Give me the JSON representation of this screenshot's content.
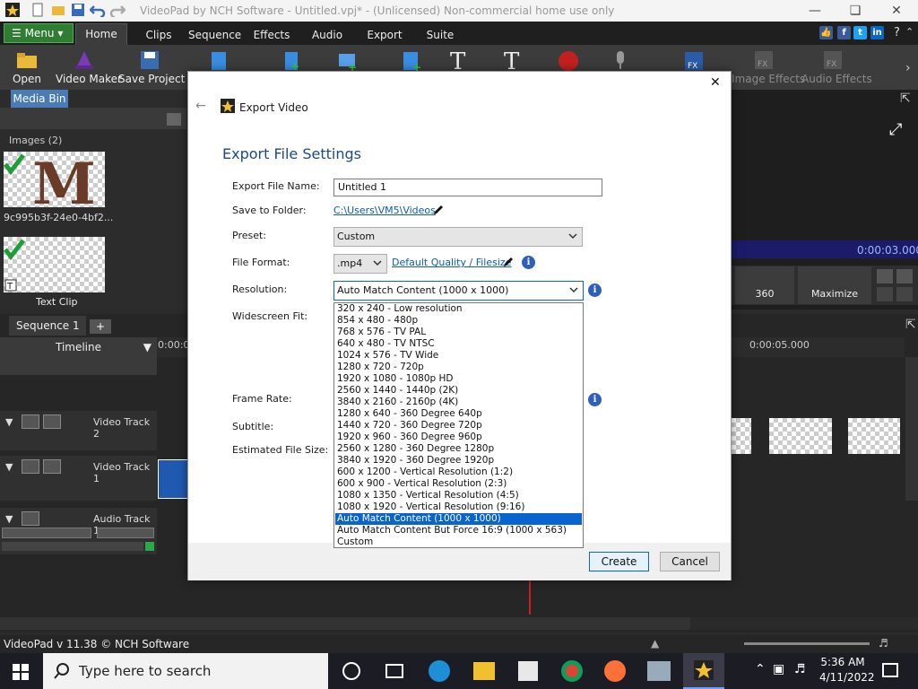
{
  "window": {
    "title": "VideoPad by NCH Software - Untitled.vpj* - (Unlicensed) Non-commercial home use only"
  },
  "tabs": {
    "menu": "Menu",
    "items": [
      "Home",
      "Clips",
      "Sequence",
      "Effects",
      "Audio",
      "Export",
      "Suite"
    ]
  },
  "toolbar": {
    "open": "Open",
    "video_maker": "Video Maker",
    "save_project": "Save Project",
    "image_effects": "Image Effects",
    "audio_effects": "Audio Effects"
  },
  "media_bin": {
    "tab": "Media Bin",
    "section": "Images (2)",
    "items": [
      {
        "label": "9c995b3f-24e0-4bf2..."
      },
      {
        "label": "Text Clip"
      }
    ]
  },
  "preview": {
    "time": "0:00:03.000",
    "btn_360": "360",
    "maximize": "Maximize"
  },
  "timeline": {
    "sequence_tab": "Sequence 1",
    "timeline_label": "Timeline",
    "ruler_start": "0:00:0",
    "ruler_mid": "0:00:05.000",
    "tracks": [
      "Video Track 2",
      "Video Track 1",
      "Audio Track 1"
    ]
  },
  "status": {
    "text": "VideoPad v 11.38 © NCH Software"
  },
  "taskbar": {
    "search_placeholder": "Type here to search",
    "time": "5:36 AM",
    "date": "4/11/2022"
  },
  "dialog": {
    "header": "Export Video",
    "heading": "Export File Settings",
    "labels": {
      "file_name": "Export File Name:",
      "folder": "Save to Folder:",
      "preset": "Preset:",
      "format": "File Format:",
      "resolution": "Resolution:",
      "widescreen": "Widescreen Fit:",
      "frame_rate": "Frame Rate:",
      "subtitle": "Subtitle:",
      "est_size": "Estimated File Size:"
    },
    "file_name": "Untitled 1",
    "folder": "C:\\Users\\VM5\\Videos",
    "preset": "Custom",
    "format": ".mp4",
    "quality_link": "Default Quality / Filesize",
    "resolution": "Auto Match Content (1000 x 1000)",
    "resolution_options": [
      "320 x 240 - Low resolution",
      "854 x 480 - 480p",
      "768 x 576 - TV PAL",
      "640 x 480 - TV NTSC",
      "1024 x 576 - TV Wide",
      "1280 x 720 - 720p",
      "1920 x 1080 - 1080p HD",
      "2560 x 1440 - 1440p (2K)",
      "3840 x 2160 - 2160p (4K)",
      "1280 x 640 - 360 Degree 640p",
      "1440 x 720 - 360 Degree 720p",
      "1920 x 960 - 360 Degree 960p",
      "2560 x 1280 - 360 Degree 1280p",
      "3840 x 1920 - 360 Degree 1920p",
      "600 x 1200 - Vertical Resolution (1:2)",
      "600 x 900 - Vertical Resolution (2:3)",
      "1080 x 1350 - Vertical Resolution (4:5)",
      "1080 x 1920 - Vertical Resolution (9:16)",
      "Auto Match Content (1000 x 1000)",
      "Auto Match Content But Force 16:9 (1000 x 563)",
      "Custom"
    ],
    "selected_index": 18,
    "create": "Create",
    "cancel": "Cancel"
  },
  "colors": {
    "accent": "#0a64cf",
    "menu_green": "#2f7d32",
    "link": "#0b5ab4",
    "media_tab": "#4a7bb5"
  }
}
